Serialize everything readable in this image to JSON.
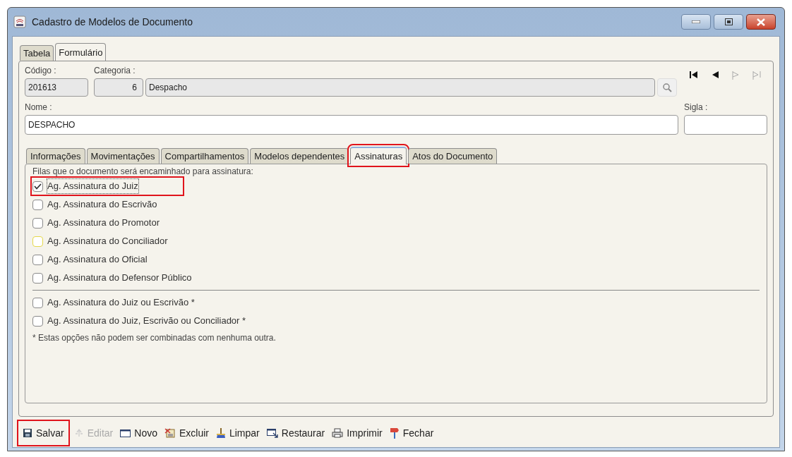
{
  "window": {
    "title": "Cadastro de Modelos de Documento"
  },
  "tabs": [
    {
      "label": "Tabela",
      "selected": false
    },
    {
      "label": "Formulário",
      "selected": true
    }
  ],
  "fields": {
    "codigo": {
      "label": "Código :",
      "value": "201613"
    },
    "categoria": {
      "label": "Categoria :",
      "code": "6",
      "value": "Despacho"
    },
    "nome": {
      "label": "Nome :",
      "value": "DESPACHO"
    },
    "sigla": {
      "label": "Sigla :"
    }
  },
  "subtabs": [
    {
      "label": "Informações",
      "selected": false,
      "highlighted": false
    },
    {
      "label": "Movimentações",
      "selected": false,
      "highlighted": false
    },
    {
      "label": "Compartilhamentos",
      "selected": false,
      "highlighted": false
    },
    {
      "label": "Modelos dependentes",
      "selected": false,
      "highlighted": false
    },
    {
      "label": "Assinaturas",
      "selected": true,
      "highlighted": true
    },
    {
      "label": "Atos do Documento",
      "selected": false,
      "highlighted": false
    }
  ],
  "assinaturas": {
    "heading": "Filas que o documento será encaminhado para assinatura:",
    "options": [
      {
        "label": "Ag. Assinatura do Juiz",
        "checked": true,
        "focused": true,
        "color": "#8a8a8a",
        "highlighted": true
      },
      {
        "label": "Ag. Assinatura do Escrivão",
        "checked": false,
        "focused": false,
        "color": "#8a8a8a",
        "highlighted": false
      },
      {
        "label": "Ag. Assinatura do Promotor",
        "checked": false,
        "focused": false,
        "color": "#8a8a8a",
        "highlighted": false
      },
      {
        "label": "Ag. Assinatura do Conciliador",
        "checked": false,
        "focused": false,
        "color": "#e5d84a",
        "highlighted": false
      },
      {
        "label": "Ag. Assinatura do Oficial",
        "checked": false,
        "focused": false,
        "color": "#8a8a8a",
        "highlighted": false
      },
      {
        "label": "Ag. Assinatura do Defensor Público",
        "checked": false,
        "focused": false,
        "color": "#8a8a8a",
        "highlighted": false
      }
    ],
    "exclusive_options": [
      {
        "label": "Ag. Assinatura do Juiz ou Escrivão *",
        "checked": false
      },
      {
        "label": "Ag. Assinatura do Juiz, Escrivão ou Conciliador *",
        "checked": false
      }
    ],
    "note": "* Estas opções não podem ser combinadas com nenhuma outra."
  },
  "toolbar": [
    {
      "label": "Salvar",
      "kind": "save",
      "disabled": false,
      "highlighted": true
    },
    {
      "label": "Editar",
      "kind": "edit",
      "disabled": true,
      "highlighted": false
    },
    {
      "label": "Novo",
      "kind": "new",
      "disabled": false,
      "highlighted": false
    },
    {
      "label": "Excluir",
      "kind": "delete",
      "disabled": false,
      "highlighted": false
    },
    {
      "label": "Limpar",
      "kind": "clear",
      "disabled": false,
      "highlighted": false
    },
    {
      "label": "Restaurar",
      "kind": "restore",
      "disabled": false,
      "highlighted": false
    },
    {
      "label": "Imprimir",
      "kind": "print",
      "disabled": false,
      "highlighted": false
    },
    {
      "label": "Fechar",
      "kind": "close",
      "disabled": false,
      "highlighted": false
    }
  ]
}
